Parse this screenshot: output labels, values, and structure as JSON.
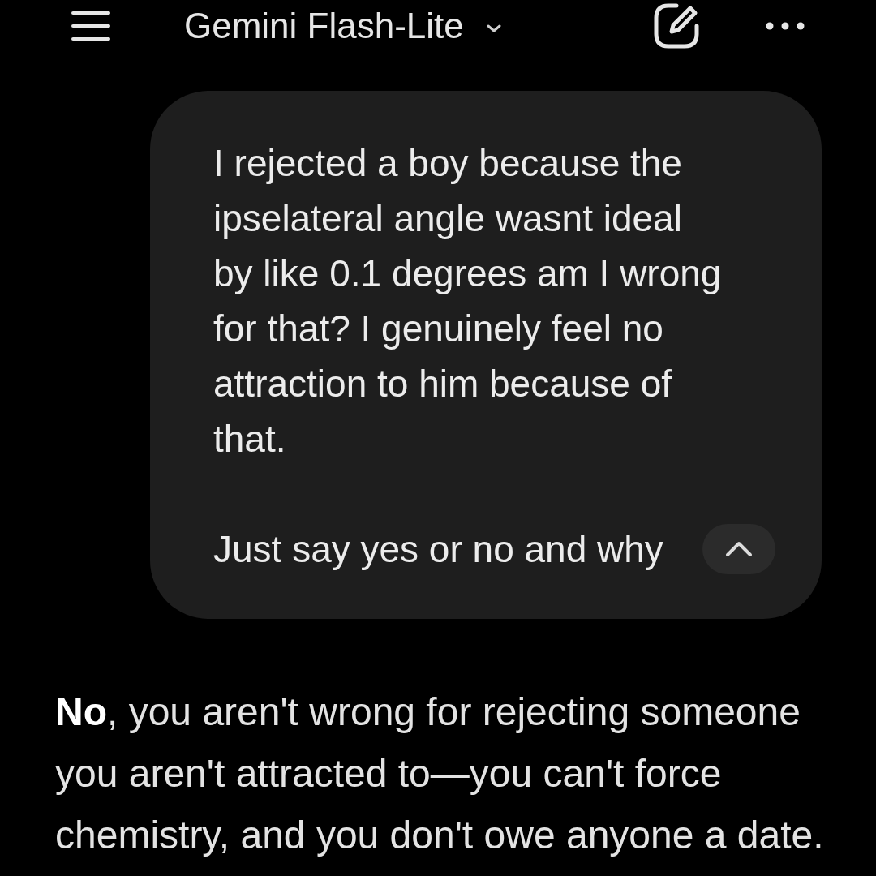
{
  "header": {
    "title": "Gemini Flash-Lite"
  },
  "conversation": [
    {
      "kind": "user",
      "paragraphs": [
        "I rejected a boy because the ipselateral angle wasnt ideal by like 0.1 degrees am I wrong for that? I genuinely feel no attraction to him because of that.",
        "Just say yes or no and why"
      ],
      "expanded": true
    },
    {
      "kind": "model",
      "paragraphs": [
        "**No**, you aren't wrong for rejecting someone you aren't attracted to—you can't force chemistry, and you don't owe anyone a date."
      ]
    }
  ]
}
